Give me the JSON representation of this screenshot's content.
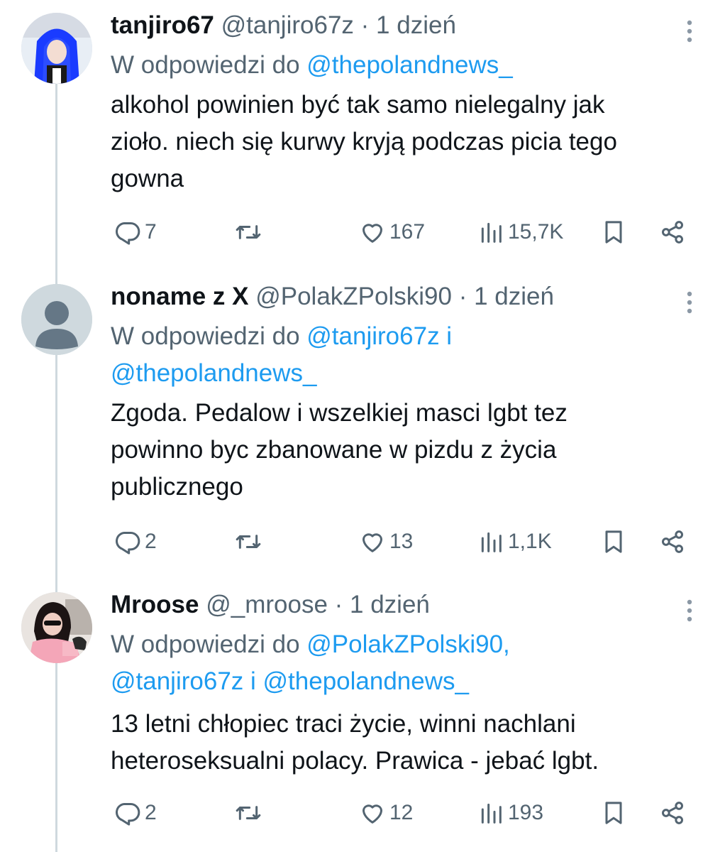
{
  "tweets": [
    {
      "name": "tanjiro67",
      "handle": "@tanjiro67z",
      "sep": "·",
      "time": "1 dzień",
      "reply_prefix": "W odpowiedzi do",
      "reply_line1": "@thepolandnews_",
      "reply_line2": "",
      "text_lines": [
        "alkohol powinien być tak samo nielegalny jak",
        "zioło. niech się kurwy kryją podczas picia tego",
        "gowna"
      ],
      "replies": "7",
      "retweets": "",
      "likes": "167",
      "views": "15,7K"
    },
    {
      "name": "noname z X",
      "handle": "@PolakZPolski90",
      "sep": "·",
      "time": "1 dzień",
      "reply_prefix": "W odpowiedzi do",
      "reply_line1": "@tanjiro67z i",
      "reply_line2": "@thepolandnews_",
      "text_lines": [
        "Zgoda. Pedalow i wszelkiej masci lgbt tez",
        "powinno byc zbanowane w pizdu z życia",
        "publicznego"
      ],
      "replies": "2",
      "retweets": "",
      "likes": "13",
      "views": "1,1K"
    },
    {
      "name": "Mroose",
      "handle": "@_mroose",
      "sep": "·",
      "time": "1 dzień",
      "reply_prefix": "W odpowiedzi do",
      "reply_line1": "@PolakZPolski90,",
      "reply_line2": "@tanjiro67z i @thepolandnews_",
      "text_lines": [
        "13 letni chłopiec traci życie, winni nachlani",
        "heteroseksualni polacy. Prawica - jebać lgbt."
      ],
      "replies": "2",
      "retweets": "",
      "likes": "12",
      "views": "193"
    }
  ],
  "colors": {
    "text": "#0f1419",
    "secondary": "#536471",
    "link": "#1d9bf0",
    "thread_line": "#cfd9de"
  },
  "icons": [
    "more-icon",
    "reply-icon",
    "retweet-icon",
    "like-icon",
    "views-icon",
    "bookmark-icon",
    "share-icon"
  ]
}
